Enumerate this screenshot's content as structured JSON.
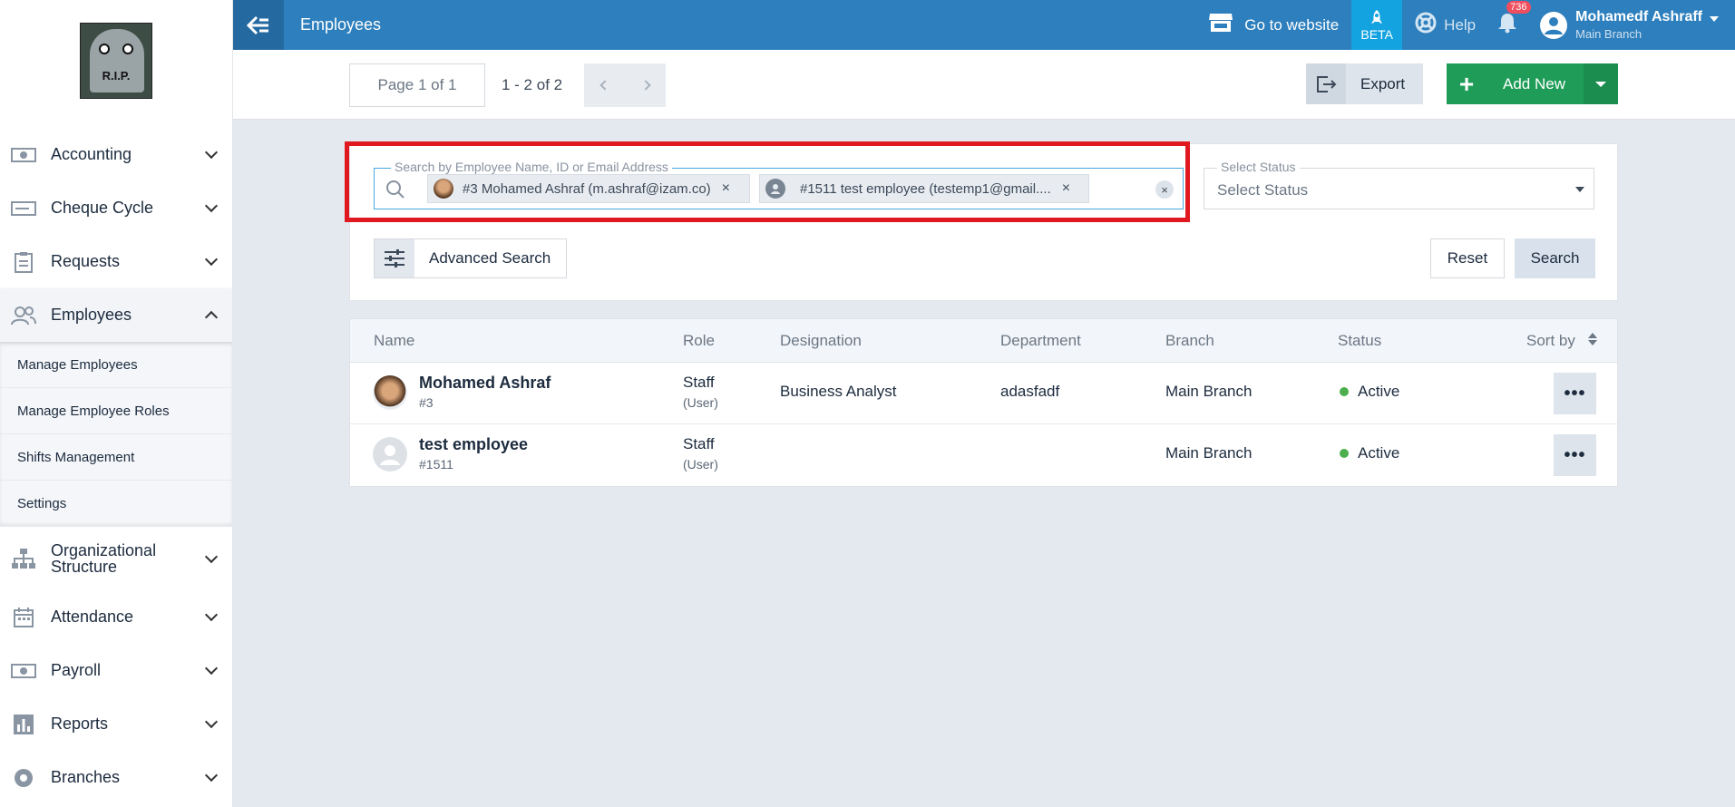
{
  "sidebar": {
    "logo_text": "R.I.P.",
    "items": [
      {
        "label": "Accounting"
      },
      {
        "label": "Cheque Cycle"
      },
      {
        "label": "Requests"
      },
      {
        "label": "Employees"
      },
      {
        "label": "Organizational Structure"
      },
      {
        "label": "Attendance"
      },
      {
        "label": "Payroll"
      },
      {
        "label": "Reports"
      },
      {
        "label": "Branches"
      }
    ],
    "submenu": [
      {
        "label": "Manage Employees"
      },
      {
        "label": "Manage Employee Roles"
      },
      {
        "label": "Shifts Management"
      },
      {
        "label": "Settings"
      }
    ]
  },
  "header": {
    "title": "Employees",
    "go_website": "Go to website",
    "beta": "BETA",
    "help": "Help",
    "notifications": "736",
    "user_name": "Mohamedf Ashraff",
    "user_branch": "Main Branch"
  },
  "toolbar": {
    "page": "Page 1 of 1",
    "range": "1 - 2 of 2",
    "export": "Export",
    "add_new": "Add New"
  },
  "filters": {
    "search_label": "Search by Employee Name, ID or Email Address",
    "chips": [
      {
        "label": "#3 Mohamed Ashraf (m.ashraf@izam.co)"
      },
      {
        "label": "#1511 test employee (testemp1@gmail...."
      }
    ],
    "status_label": "Select Status",
    "status_value": "Select Status",
    "advanced_search": "Advanced Search",
    "reset": "Reset",
    "search": "Search"
  },
  "table": {
    "headers": {
      "name": "Name",
      "role": "Role",
      "designation": "Designation",
      "department": "Department",
      "branch": "Branch",
      "status": "Status",
      "sort_by": "Sort by"
    },
    "rows": [
      {
        "name": "Mohamed Ashraf",
        "id": "#3",
        "role": "Staff",
        "role_sub": "(User)",
        "designation": "Business Analyst",
        "department": "adasfadf",
        "branch": "Main Branch",
        "status": "Active"
      },
      {
        "name": "test employee",
        "id": "#1511",
        "role": "Staff",
        "role_sub": "(User)",
        "designation": "",
        "department": "",
        "branch": "Main Branch",
        "status": "Active"
      }
    ]
  },
  "colors": {
    "topbar": "#2d7fbd",
    "beta": "#13a3e0",
    "add_new": "#1f9d58",
    "highlight": "#e01820",
    "status_active": "#4cae4c"
  },
  "more_label": "•••"
}
